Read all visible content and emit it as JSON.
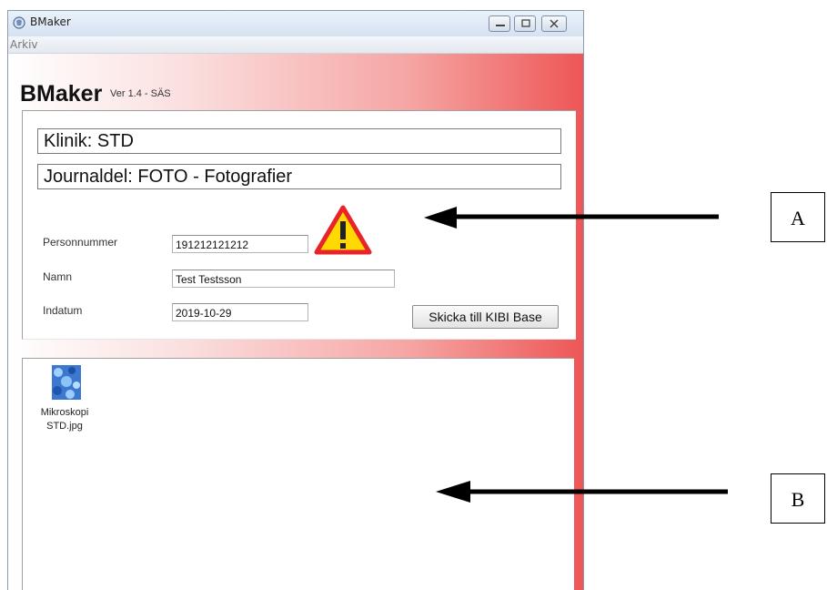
{
  "window": {
    "title": "BMaker",
    "menu": [
      "Arkiv"
    ]
  },
  "app": {
    "brand": "BMaker",
    "version": "Ver 1.4 - SÄS"
  },
  "form": {
    "clinic": "Klinik: STD",
    "journal_part": "Journaldel: FOTO - Fotografier",
    "fields": [
      {
        "label": "Personnummer",
        "value": "191212121212"
      },
      {
        "label": "Namn",
        "value": "Test Testsson"
      },
      {
        "label": "Indatum",
        "value": "2019-10-29"
      }
    ],
    "send_button": "Skicka till KIBI Base"
  },
  "files": [
    {
      "name_line1": "Mikroskopi",
      "name_line2": "STD.jpg"
    }
  ],
  "annotations": {
    "a": "A",
    "b": "B"
  },
  "colors": {
    "warning": "#e8242a",
    "warning_fill": "#ffd900",
    "gradient_right": "#ee5656"
  }
}
